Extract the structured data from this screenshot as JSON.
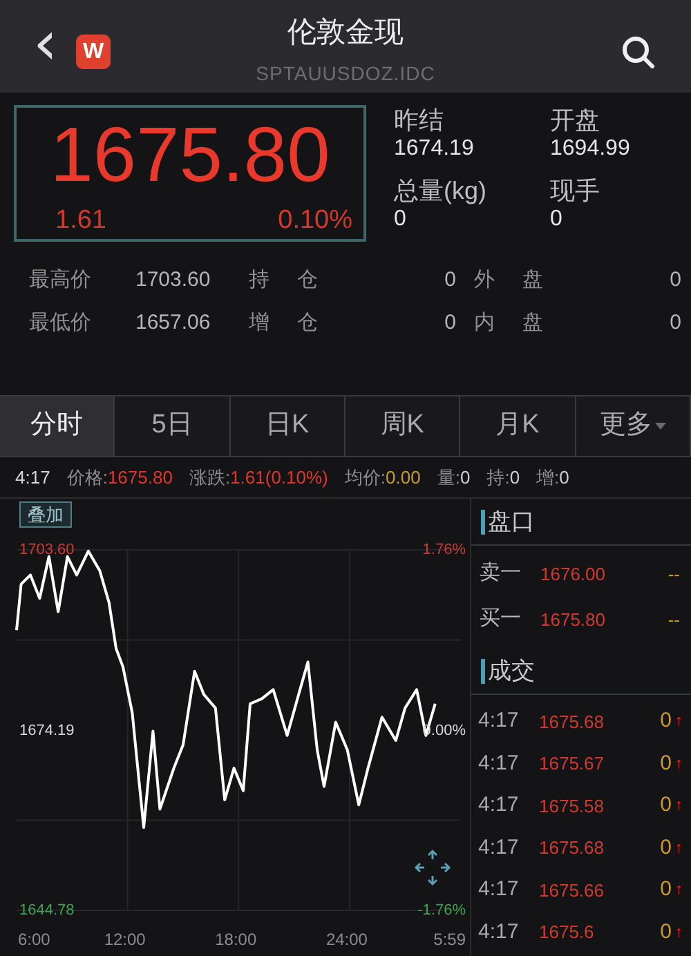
{
  "header": {
    "title": "伦敦金现",
    "code": "SPTAUUSDOZ.IDC",
    "back": "‹",
    "logo": "W"
  },
  "quote": {
    "price": "1675.80",
    "change": "1.61",
    "percent": "0.10%"
  },
  "side_stats": [
    {
      "label": "昨结",
      "value": "1674.19"
    },
    {
      "label": "开盘",
      "value": "1694.99"
    },
    {
      "label": "总量(kg)",
      "value": "0"
    },
    {
      "label": "现手",
      "value": "0"
    }
  ],
  "stats_rows": [
    {
      "label": "最高价",
      "value": "1703.60",
      "label_2": "持仓",
      "value_2": "0",
      "label_3": "外盘",
      "value_3": "0"
    },
    {
      "label": "最低价",
      "value": "1657.06",
      "label_2": "增仓",
      "value_2": "0",
      "label_3": "内盘",
      "value_3": "0"
    }
  ],
  "tabs": [
    {
      "label": "分时",
      "selected": true
    },
    {
      "label": "5日",
      "selected": false
    },
    {
      "label": "日K",
      "selected": false
    },
    {
      "label": "周K",
      "selected": false
    },
    {
      "label": "月K",
      "selected": false
    },
    {
      "label": "更多",
      "selected": false,
      "dropdown": true
    }
  ],
  "info_line": {
    "time": "4:17",
    "items": [
      {
        "label": "价格:",
        "value": "1675.80",
        "color": "#e0362c"
      },
      {
        "label": "涨跌:",
        "value": "1.61(0.10%)",
        "color": "#e0362c"
      },
      {
        "label": "均价:",
        "value": "0.00",
        "color": "#c99a2e"
      },
      {
        "label": "量:",
        "value": "0",
        "color": "#cfcfd3"
      },
      {
        "label": "持:",
        "value": "0",
        "color": "#cfcfd3"
      },
      {
        "label": "增:",
        "value": "0",
        "color": "#cfcfd3"
      }
    ]
  },
  "chart": {
    "overlay_button": "叠加",
    "end_time_label": "5:59",
    "pct_labels": [
      "1.76%",
      "0.00%",
      "-1.76%"
    ],
    "chart_data": {
      "type": "line",
      "x": [
        6,
        6.25,
        6.75,
        7.25,
        7.75,
        8.25,
        8.75,
        9.25,
        9.875,
        10.5,
        11,
        11.375,
        11.75,
        12.25,
        12.5,
        12.875,
        13.375,
        13.75,
        14.5,
        15,
        15.625,
        16.125,
        16.75,
        17.25,
        17.75,
        18.25,
        18.625,
        19.25,
        19.875,
        20.625,
        21.25,
        21.75,
        22.25,
        22.625,
        23.25,
        23.875,
        24.5,
        25,
        25.75,
        26.5,
        27,
        27.625,
        28.125,
        28.625
      ],
      "series": [
        {
          "color": "#ffffff",
          "values": [
            1690.5,
            1698,
            1699.5,
            1695.7,
            1702.5,
            1693.5,
            1702.5,
            1699.5,
            1703.4,
            1700.2,
            1695,
            1687.5,
            1684.5,
            1677,
            1669.5,
            1658.3,
            1674,
            1661.3,
            1668,
            1671.8,
            1683.8,
            1680,
            1677.8,
            1662.8,
            1668,
            1664.3,
            1678.5,
            1679.3,
            1680.8,
            1673.3,
            1680,
            1685.3,
            1671,
            1665,
            1675.5,
            1671,
            1662,
            1668,
            1676.3,
            1672.5,
            1677.8,
            1680.8,
            1673.3,
            1678.5
          ]
        }
      ],
      "grid": true,
      "xlim": [
        6,
        29.98
      ],
      "ylim": [
        1644.78,
        1703.6
      ],
      "xticks": [
        {
          "value": 6,
          "label": "6:00"
        },
        {
          "value": 12,
          "label": "12:00"
        },
        {
          "value": 18,
          "label": "18:00"
        },
        {
          "value": 24,
          "label": "24:00"
        }
      ],
      "yticks": [
        {
          "value": 1644.78,
          "label": "1644.78"
        },
        {
          "value": 1674.19,
          "label": "1674.19"
        },
        {
          "value": 1703.6,
          "label": "1703.60"
        }
      ]
    }
  },
  "order_book": {
    "title": "盘口",
    "rows": [
      {
        "label": "卖一",
        "price": "1676.00",
        "volume": "--"
      },
      {
        "label": "买一",
        "price": "1675.80",
        "volume": "--"
      }
    ]
  },
  "trades": {
    "title": "成交",
    "rows": [
      {
        "time": "4:17",
        "price": "1675.68",
        "volume": "0",
        "arrow": "↑"
      },
      {
        "time": "4:17",
        "price": "1675.67",
        "volume": "0",
        "arrow": "↑"
      },
      {
        "time": "4:17",
        "price": "1675.58",
        "volume": "0",
        "arrow": "↑"
      },
      {
        "time": "4:17",
        "price": "1675.68",
        "volume": "0",
        "arrow": "↑"
      },
      {
        "time": "4:17",
        "price": "1675.66",
        "volume": "0",
        "arrow": "↑"
      },
      {
        "time": "4:17",
        "price": "1675.6",
        "volume": "0",
        "arrow": "↑"
      }
    ]
  }
}
